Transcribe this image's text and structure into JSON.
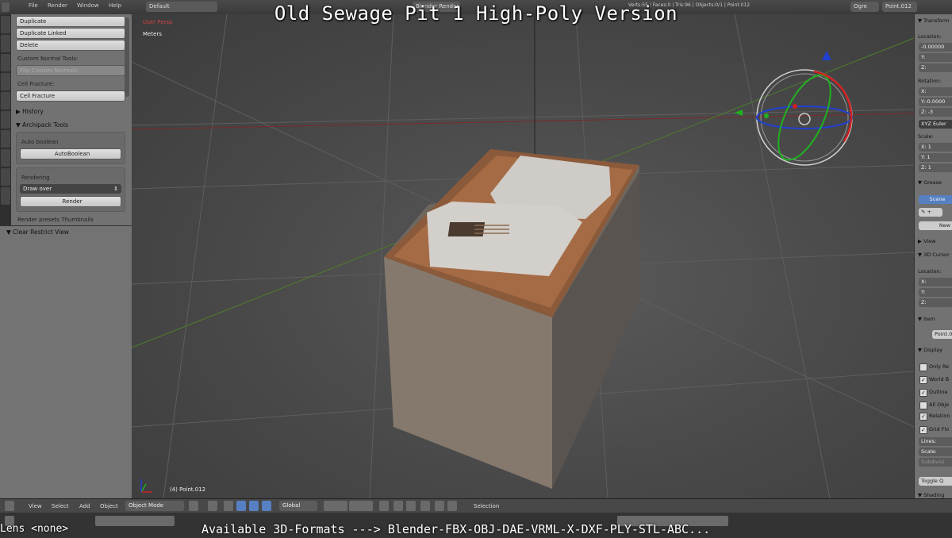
{
  "overlay": {
    "title": "Old Sewage Pit 1 High-Poly Version",
    "bottom_text": "Available 3D-Formats ---> Blender-FBX-OBJ-DAE-VRML-X-DXF-PLY-STL-ABC...",
    "lens_text": "Lens <none>"
  },
  "topbar": {
    "menus": [
      "File",
      "Render",
      "Window",
      "Help"
    ],
    "layout": "Default",
    "engine": "Blender Render",
    "verts": "Verts:55 | Faces:0 | Tris:96 | Objects:0/1 | Point.012",
    "render_mode": "Ogre",
    "object_name": "Point.012"
  },
  "toolshelf": {
    "buttons_top": [
      "Duplicate",
      "Duplicate Linked",
      "Delete"
    ],
    "custom_normal_label": "Custom Normal Tools:",
    "flip_normals": "Flip Custom Normals",
    "cell_fracture_label": "Cell Fracture:",
    "cell_fracture_btn": "Cell Fracture",
    "history": "History",
    "archipack": "Archipack Tools",
    "auto_boolean_label": "Auto boolean",
    "auto_boolean_btn": "AutoBoolean",
    "rendering_label": "Rendering",
    "draw_over": "Draw over",
    "render_btn": "Render",
    "render_presets": "Render presets Thumbnails"
  },
  "lower_left": {
    "header": "Clear Restrict View"
  },
  "viewport": {
    "view_name": "User Persp",
    "units": "Meters",
    "object_label": "(4) Point.012"
  },
  "right_panel": {
    "transform": "Transform",
    "location": "Location:",
    "loc": [
      "-0.00000",
      "Y:",
      "Z:"
    ],
    "rotation": "Rotation:",
    "rot": [
      "X:",
      "Y:-0.0000",
      "Z: -3"
    ],
    "euler": "XYZ Euler",
    "scale": "Scale:",
    "scl": [
      "X: 1",
      "Y: 1",
      "Z: 1"
    ],
    "grease": "Grease",
    "scene": "Scene",
    "new": "New",
    "view": "View",
    "cursor": "3D Cursor",
    "cursor_location": "Location:",
    "cur": [
      "X:",
      "Y:",
      "Z:"
    ],
    "item": "Item",
    "item_name": "Point.0",
    "display": "Display",
    "display_opts": [
      "Only Re",
      "World B",
      "Outline",
      "All Obje",
      "Relation",
      "Grid Flo"
    ],
    "lines": "Lines:",
    "scale2": "Scale:",
    "subdivisions": "Subdivisi",
    "toggle": "Toggle Q",
    "shading": "Shading"
  },
  "bottom_header": {
    "menus": [
      "View",
      "Select",
      "Add",
      "Object"
    ],
    "mode": "Object Mode",
    "orientation": "Global",
    "selection": "Selection"
  },
  "colors": {
    "accent": "#5680c2",
    "axis_x": "#d02020",
    "axis_y": "#20b020",
    "axis_z": "#2040d0"
  }
}
